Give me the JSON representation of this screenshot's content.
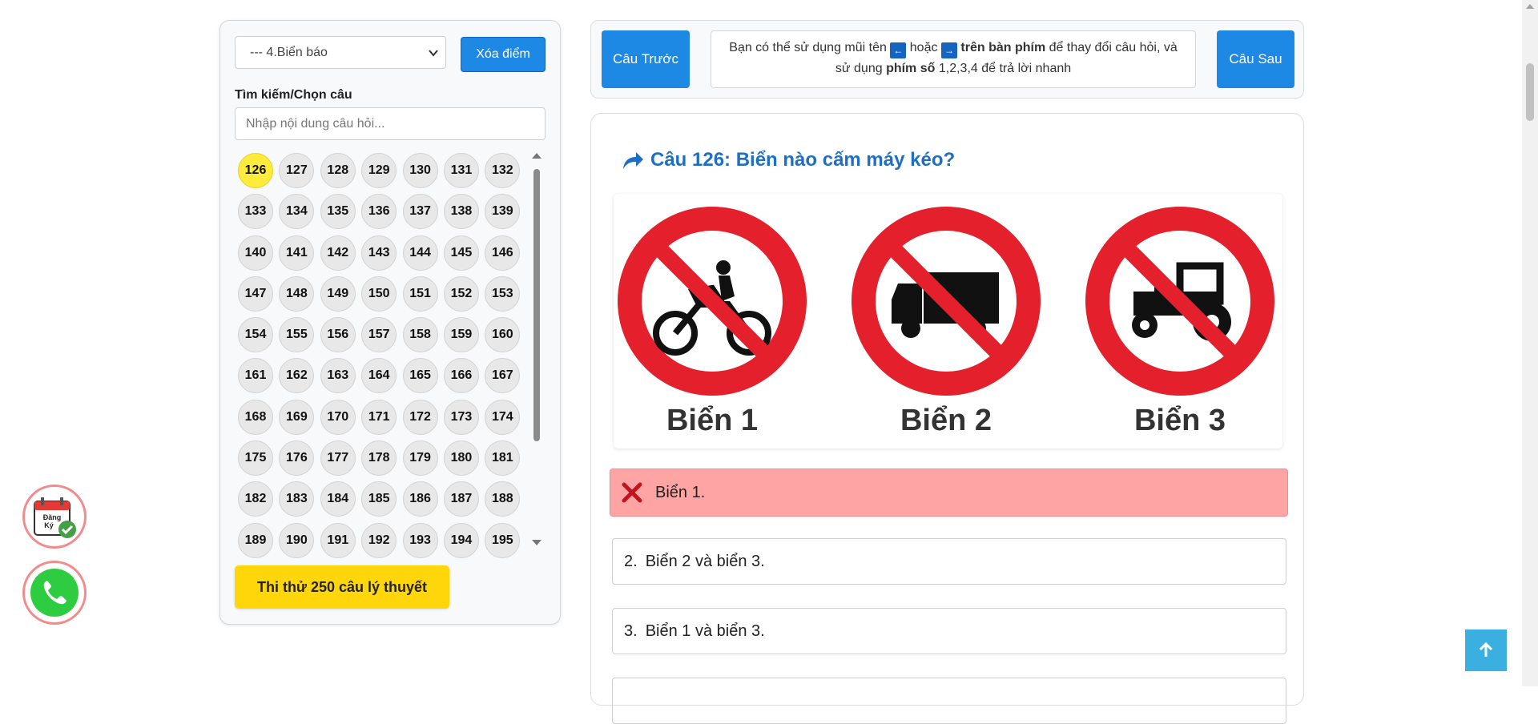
{
  "sidebar": {
    "topic_select": "--- 4.Biển báo",
    "clear_button": "Xóa điểm",
    "search_label": "Tìm kiếm/Chọn câu",
    "search_placeholder": "Nhập nội dung câu hỏi...",
    "question_numbers": [
      "126",
      "127",
      "128",
      "129",
      "130",
      "131",
      "132",
      "133",
      "134",
      "135",
      "136",
      "137",
      "138",
      "139",
      "140",
      "141",
      "142",
      "143",
      "144",
      "145",
      "146",
      "147",
      "148",
      "149",
      "150",
      "151",
      "152",
      "153",
      "154",
      "155",
      "156",
      "157",
      "158",
      "159",
      "160",
      "161",
      "162",
      "163",
      "164",
      "165",
      "166",
      "167",
      "168",
      "169",
      "170",
      "171",
      "172",
      "173",
      "174",
      "175",
      "176",
      "177",
      "178",
      "179",
      "180",
      "181",
      "182",
      "183",
      "184",
      "185",
      "186",
      "187",
      "188",
      "189",
      "190",
      "191",
      "192",
      "193",
      "194",
      "195"
    ],
    "active_question": "126",
    "exam_button": "Thi thử 250 câu lý thuyết"
  },
  "nav": {
    "prev_button": "Câu Trước",
    "next_button": "Câu Sau",
    "hint_part1": "Bạn có thể sử dụng mũi tên",
    "hint_left_key": "←",
    "hint_or": "hoặc",
    "hint_right_key": "→",
    "hint_bold1": "trên bàn phím",
    "hint_part2": "để thay đổi câu hỏi, và",
    "hint_part3": "sử dụng",
    "hint_bold2": "phím số",
    "hint_part4": "1,2,3,4 để trả lời nhanh"
  },
  "question": {
    "title": "Câu 126: Biển nào cấm máy kéo?",
    "sign_labels": [
      "Biển 1",
      "Biển 2",
      "Biển 3"
    ],
    "answers": [
      {
        "number": "",
        "text": "Biển 1.",
        "state": "wrong"
      },
      {
        "number": "2.",
        "text": "Biển 2 và biển 3.",
        "state": "normal"
      },
      {
        "number": "3.",
        "text": "Biển 1 và biển 3.",
        "state": "normal"
      }
    ]
  },
  "floating": {
    "register_label_1": "Đăng",
    "register_label_2": "Ký"
  },
  "colors": {
    "accent": "#1e88e5",
    "active_number": "#ffeb3b",
    "wrong_answer": "#ffa4a4",
    "exam_button": "#ffd60a",
    "title": "#1e6fc4"
  }
}
